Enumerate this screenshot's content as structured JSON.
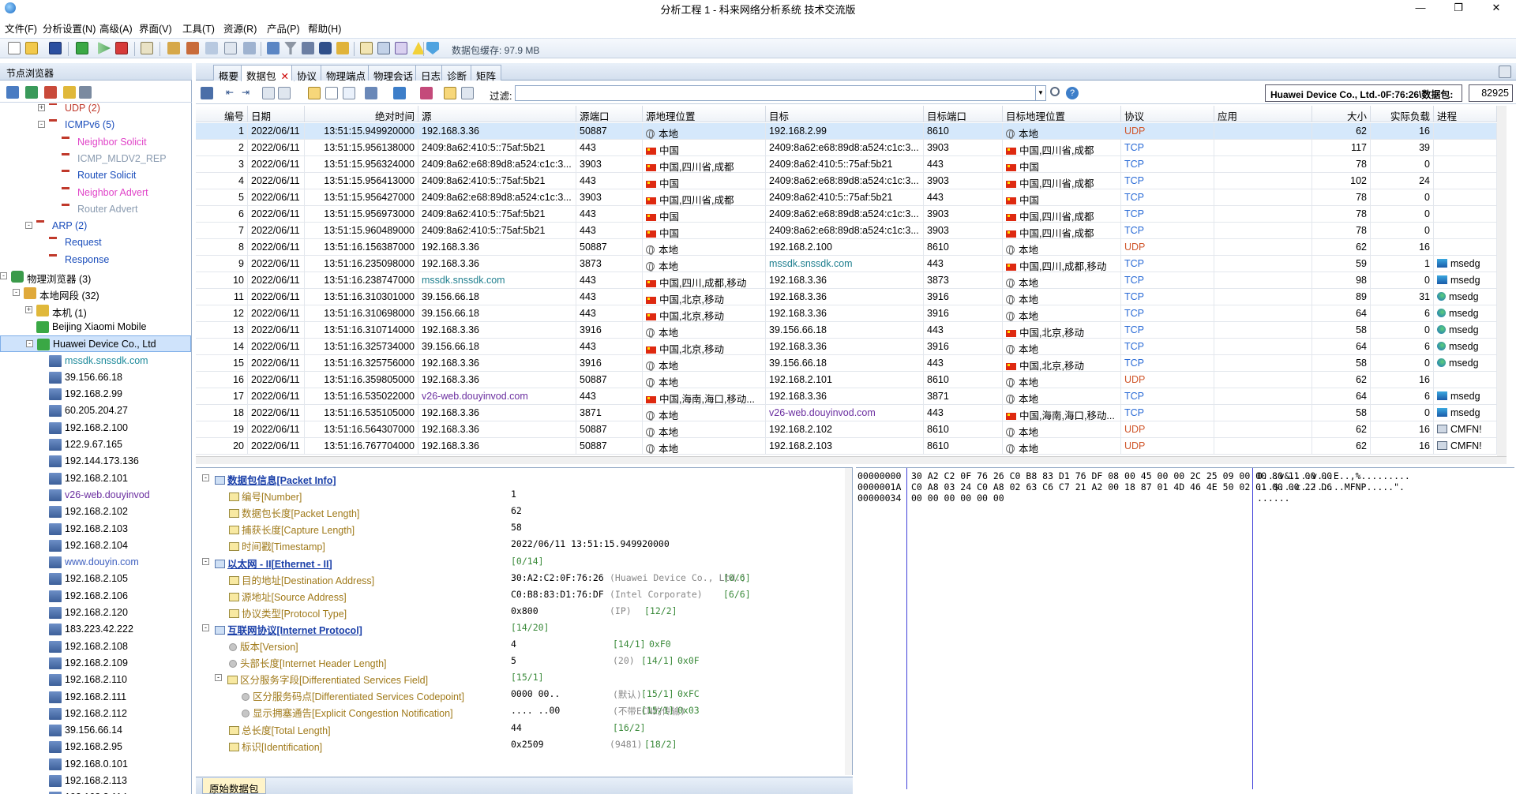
{
  "window": {
    "title": "分析工程 1 - 科来网络分析系统 技术交流版",
    "minimize": "—",
    "maximize": "❐",
    "close": "✕"
  },
  "menu": [
    "文件(F)",
    "分析设置(N)",
    "高级(A)",
    "界面(V)",
    "工具(T)",
    "资源(R)",
    "产品(P)",
    "帮助(H)"
  ],
  "toolbar": {
    "cache_label": "数据包缓存: 97.9 MB"
  },
  "left_panel": {
    "title": "节点浏览器",
    "tree": [
      {
        "label": "UDP (2)",
        "color": "red",
        "level": 4,
        "icon": "protocol-icon",
        "expander": "+"
      },
      {
        "label": "ICMPv6 (5)",
        "color": "blue",
        "level": 4,
        "icon": "protocol-icon",
        "expander": "-"
      },
      {
        "label": "Neighbor Solicit",
        "color": "pink",
        "level": 5,
        "icon": "protocol-icon"
      },
      {
        "label": "ICMP_MLDV2_REP",
        "color": "gray",
        "level": 5,
        "icon": "protocol-icon"
      },
      {
        "label": "Router Solicit",
        "color": "blue",
        "level": 5,
        "icon": "protocol-icon"
      },
      {
        "label": "Neighbor Advert",
        "color": "pink",
        "level": 5,
        "icon": "protocol-icon"
      },
      {
        "label": "Router Advert",
        "color": "gray",
        "level": 5,
        "icon": "protocol-icon"
      },
      {
        "label": "ARP (2)",
        "color": "blue",
        "level": 3,
        "icon": "protocol-icon",
        "expander": "-"
      },
      {
        "label": "Request",
        "color": "blue",
        "level": 4,
        "icon": "protocol-icon"
      },
      {
        "label": "Response",
        "color": "blue",
        "level": 4,
        "icon": "protocol-icon"
      },
      {
        "label": "物理浏览器 (3)",
        "color": "black",
        "level": 1,
        "icon": "physical-icon",
        "expander": "-"
      },
      {
        "label": "本地网段 (32)",
        "color": "black",
        "level": 2,
        "icon": "segment-icon",
        "expander": "-"
      },
      {
        "label": "本机 (1)",
        "color": "black",
        "level": 3,
        "icon": "host-icon",
        "expander": "+"
      },
      {
        "label": "Beijing Xiaomi Mobile",
        "color": "black",
        "level": 3,
        "icon": "node-icon"
      },
      {
        "label": "Huawei Device Co., Ltd",
        "color": "black",
        "level": 3,
        "icon": "node-icon",
        "expander": "-",
        "selected": true
      },
      {
        "label": "mssdk.snssdk.com",
        "color": "teal",
        "level": 4,
        "icon": "pc-icon"
      },
      {
        "label": "39.156.66.18",
        "color": "black",
        "level": 4,
        "icon": "pc-icon"
      },
      {
        "label": "192.168.2.99",
        "color": "black",
        "level": 4,
        "icon": "pc-icon"
      },
      {
        "label": "60.205.204.27",
        "color": "black",
        "level": 4,
        "icon": "pc-icon"
      },
      {
        "label": "192.168.2.100",
        "color": "black",
        "level": 4,
        "icon": "pc-icon"
      },
      {
        "label": "122.9.67.165",
        "color": "black",
        "level": 4,
        "icon": "pc-icon"
      },
      {
        "label": "192.144.173.136",
        "color": "black",
        "level": 4,
        "icon": "pc-icon"
      },
      {
        "label": "192.168.2.101",
        "color": "black",
        "level": 4,
        "icon": "pc-icon"
      },
      {
        "label": "v26-web.douyinvod",
        "color": "purple",
        "level": 4,
        "icon": "pc-icon"
      },
      {
        "label": "192.168.2.102",
        "color": "black",
        "level": 4,
        "icon": "pc-icon"
      },
      {
        "label": "192.168.2.103",
        "color": "black",
        "level": 4,
        "icon": "pc-icon"
      },
      {
        "label": "192.168.2.104",
        "color": "black",
        "level": 4,
        "icon": "pc-icon"
      },
      {
        "label": "www.douyin.com",
        "color": "link",
        "level": 4,
        "icon": "pc-icon"
      },
      {
        "label": "192.168.2.105",
        "color": "black",
        "level": 4,
        "icon": "pc-icon"
      },
      {
        "label": "192.168.2.106",
        "color": "black",
        "level": 4,
        "icon": "pc-icon"
      },
      {
        "label": "192.168.2.120",
        "color": "black",
        "level": 4,
        "icon": "pc-icon"
      },
      {
        "label": "183.223.42.222",
        "color": "black",
        "level": 4,
        "icon": "pc-icon"
      },
      {
        "label": "192.168.2.108",
        "color": "black",
        "level": 4,
        "icon": "pc-icon"
      },
      {
        "label": "192.168.2.109",
        "color": "black",
        "level": 4,
        "icon": "pc-icon"
      },
      {
        "label": "192.168.2.110",
        "color": "black",
        "level": 4,
        "icon": "pc-icon"
      },
      {
        "label": "192.168.2.111",
        "color": "black",
        "level": 4,
        "icon": "pc-icon"
      },
      {
        "label": "192.168.2.112",
        "color": "black",
        "level": 4,
        "icon": "pc-icon"
      },
      {
        "label": "39.156.66.14",
        "color": "black",
        "level": 4,
        "icon": "pc-icon"
      },
      {
        "label": "192.168.2.95",
        "color": "black",
        "level": 4,
        "icon": "pc-icon"
      },
      {
        "label": "192.168.0.101",
        "color": "black",
        "level": 4,
        "icon": "pc-icon"
      },
      {
        "label": "192.168.2.113",
        "color": "black",
        "level": 4,
        "icon": "pc-icon"
      },
      {
        "label": "192.168.2.114",
        "color": "black",
        "level": 4,
        "icon": "pc-icon"
      }
    ]
  },
  "tabs": [
    {
      "label": "概要",
      "active": false
    },
    {
      "label": "数据包",
      "active": true,
      "close": "✕"
    },
    {
      "label": "协议",
      "active": false
    },
    {
      "label": "物理端点",
      "active": false
    },
    {
      "label": "物理会话",
      "active": false
    },
    {
      "label": "日志",
      "active": false
    },
    {
      "label": "诊断",
      "active": false
    },
    {
      "label": "矩阵",
      "active": false
    }
  ],
  "filterbar": {
    "filter_label": "过滤:",
    "filter_value": "",
    "device_label": "Huawei Device Co., Ltd.-0F:76:26\\数据包:",
    "packet_count": "82925"
  },
  "packet_table": {
    "columns": [
      "编号",
      "日期",
      "绝对时间",
      "源",
      "源端口",
      "源地理位置",
      "目标",
      "目标端口",
      "目标地理位置",
      "协议",
      "应用",
      "大小",
      "实际负载",
      "进程"
    ],
    "rows": [
      {
        "no": "1",
        "date": "2022/06/11",
        "time": "13:51:15.949920000",
        "src": "192.168.3.36",
        "sport": "50887",
        "sgeo": "本地",
        "sflag": "local",
        "dst": "192.168.2.99",
        "dport": "8610",
        "dgeo": "本地",
        "dflag": "local",
        "proto": "UDP",
        "app": "",
        "size": "62",
        "payload": "16",
        "proc": "",
        "selected": true
      },
      {
        "no": "2",
        "date": "2022/06/11",
        "time": "13:51:15.956138000",
        "src": "2409:8a62:410:5::75af:5b21",
        "sport": "443",
        "sgeo": "中国",
        "sflag": "cn",
        "dst": "2409:8a62:e68:89d8:a524:c1c:3...",
        "dport": "3903",
        "dgeo": "中国,四川省,成都",
        "dflag": "cn",
        "proto": "TCP",
        "app": "",
        "size": "117",
        "payload": "39",
        "proc": ""
      },
      {
        "no": "3",
        "date": "2022/06/11",
        "time": "13:51:15.956324000",
        "src": "2409:8a62:e68:89d8:a524:c1c:3...",
        "sport": "3903",
        "sgeo": "中国,四川省,成都",
        "sflag": "cn",
        "dst": "2409:8a62:410:5::75af:5b21",
        "dport": "443",
        "dgeo": "中国",
        "dflag": "cn",
        "proto": "TCP",
        "app": "",
        "size": "78",
        "payload": "0",
        "proc": ""
      },
      {
        "no": "4",
        "date": "2022/06/11",
        "time": "13:51:15.956413000",
        "src": "2409:8a62:410:5::75af:5b21",
        "sport": "443",
        "sgeo": "中国",
        "sflag": "cn",
        "dst": "2409:8a62:e68:89d8:a524:c1c:3...",
        "dport": "3903",
        "dgeo": "中国,四川省,成都",
        "dflag": "cn",
        "proto": "TCP",
        "app": "",
        "size": "102",
        "payload": "24",
        "proc": ""
      },
      {
        "no": "5",
        "date": "2022/06/11",
        "time": "13:51:15.956427000",
        "src": "2409:8a62:e68:89d8:a524:c1c:3...",
        "sport": "3903",
        "sgeo": "中国,四川省,成都",
        "sflag": "cn",
        "dst": "2409:8a62:410:5::75af:5b21",
        "dport": "443",
        "dgeo": "中国",
        "dflag": "cn",
        "proto": "TCP",
        "app": "",
        "size": "78",
        "payload": "0",
        "proc": ""
      },
      {
        "no": "6",
        "date": "2022/06/11",
        "time": "13:51:15.956973000",
        "src": "2409:8a62:410:5::75af:5b21",
        "sport": "443",
        "sgeo": "中国",
        "sflag": "cn",
        "dst": "2409:8a62:e68:89d8:a524:c1c:3...",
        "dport": "3903",
        "dgeo": "中国,四川省,成都",
        "dflag": "cn",
        "proto": "TCP",
        "app": "",
        "size": "78",
        "payload": "0",
        "proc": ""
      },
      {
        "no": "7",
        "date": "2022/06/11",
        "time": "13:51:15.960489000",
        "src": "2409:8a62:410:5::75af:5b21",
        "sport": "443",
        "sgeo": "中国",
        "sflag": "cn",
        "dst": "2409:8a62:e68:89d8:a524:c1c:3...",
        "dport": "3903",
        "dgeo": "中国,四川省,成都",
        "dflag": "cn",
        "proto": "TCP",
        "app": "",
        "size": "78",
        "payload": "0",
        "proc": ""
      },
      {
        "no": "8",
        "date": "2022/06/11",
        "time": "13:51:16.156387000",
        "src": "192.168.3.36",
        "sport": "50887",
        "sgeo": "本地",
        "sflag": "local",
        "dst": "192.168.2.100",
        "dport": "8610",
        "dgeo": "本地",
        "dflag": "local",
        "proto": "UDP",
        "app": "",
        "size": "62",
        "payload": "16",
        "proc": ""
      },
      {
        "no": "9",
        "date": "2022/06/11",
        "time": "13:51:16.235098000",
        "src": "192.168.3.36",
        "sport": "3873",
        "sgeo": "本地",
        "sflag": "local",
        "dst": "mssdk.snssdk.com",
        "dstcls": "domain",
        "dport": "443",
        "dgeo": "中国,四川,成都,移动",
        "dflag": "cn",
        "proto": "TCP",
        "app": "",
        "size": "59",
        "payload": "1",
        "proc": "msedg",
        "pico": "monitor"
      },
      {
        "no": "10",
        "date": "2022/06/11",
        "time": "13:51:16.238747000",
        "src": "mssdk.snssdk.com",
        "srccls": "domain",
        "sport": "443",
        "sgeo": "中国,四川,成都,移动",
        "sflag": "cn",
        "dst": "192.168.3.36",
        "dport": "3873",
        "dgeo": "本地",
        "dflag": "local",
        "proto": "TCP",
        "app": "",
        "size": "98",
        "payload": "0",
        "proc": "msedg",
        "pico": "monitor"
      },
      {
        "no": "11",
        "date": "2022/06/11",
        "time": "13:51:16.310301000",
        "src": "39.156.66.18",
        "sport": "443",
        "sgeo": "中国,北京,移动",
        "sflag": "cn",
        "dst": "192.168.3.36",
        "dport": "3916",
        "dgeo": "本地",
        "dflag": "local",
        "proto": "TCP",
        "app": "",
        "size": "89",
        "payload": "31",
        "proc": "msedg",
        "pico": "edge"
      },
      {
        "no": "12",
        "date": "2022/06/11",
        "time": "13:51:16.310698000",
        "src": "39.156.66.18",
        "sport": "443",
        "sgeo": "中国,北京,移动",
        "sflag": "cn",
        "dst": "192.168.3.36",
        "dport": "3916",
        "dgeo": "本地",
        "dflag": "local",
        "proto": "TCP",
        "app": "",
        "size": "64",
        "payload": "6",
        "proc": "msedg",
        "pico": "edge"
      },
      {
        "no": "13",
        "date": "2022/06/11",
        "time": "13:51:16.310714000",
        "src": "192.168.3.36",
        "sport": "3916",
        "sgeo": "本地",
        "sflag": "local",
        "dst": "39.156.66.18",
        "dport": "443",
        "dgeo": "中国,北京,移动",
        "dflag": "cn",
        "proto": "TCP",
        "app": "",
        "size": "58",
        "payload": "0",
        "proc": "msedg",
        "pico": "edge"
      },
      {
        "no": "14",
        "date": "2022/06/11",
        "time": "13:51:16.325734000",
        "src": "39.156.66.18",
        "sport": "443",
        "sgeo": "中国,北京,移动",
        "sflag": "cn",
        "dst": "192.168.3.36",
        "dport": "3916",
        "dgeo": "本地",
        "dflag": "local",
        "proto": "TCP",
        "app": "",
        "size": "64",
        "payload": "6",
        "proc": "msedg",
        "pico": "edge"
      },
      {
        "no": "15",
        "date": "2022/06/11",
        "time": "13:51:16.325756000",
        "src": "192.168.3.36",
        "sport": "3916",
        "sgeo": "本地",
        "sflag": "local",
        "dst": "39.156.66.18",
        "dport": "443",
        "dgeo": "中国,北京,移动",
        "dflag": "cn",
        "proto": "TCP",
        "app": "",
        "size": "58",
        "payload": "0",
        "proc": "msedg",
        "pico": "edge"
      },
      {
        "no": "16",
        "date": "2022/06/11",
        "time": "13:51:16.359805000",
        "src": "192.168.3.36",
        "sport": "50887",
        "sgeo": "本地",
        "sflag": "local",
        "dst": "192.168.2.101",
        "dport": "8610",
        "dgeo": "本地",
        "dflag": "local",
        "proto": "UDP",
        "app": "",
        "size": "62",
        "payload": "16",
        "proc": ""
      },
      {
        "no": "17",
        "date": "2022/06/11",
        "time": "13:51:16.535022000",
        "src": "v26-web.douyinvod.com",
        "srccls": "domain2",
        "sport": "443",
        "sgeo": "中国,海南,海口,移动...",
        "sflag": "cn",
        "dst": "192.168.3.36",
        "dport": "3871",
        "dgeo": "本地",
        "dflag": "local",
        "proto": "TCP",
        "app": "",
        "size": "64",
        "payload": "6",
        "proc": "msedg",
        "pico": "monitor"
      },
      {
        "no": "18",
        "date": "2022/06/11",
        "time": "13:51:16.535105000",
        "src": "192.168.3.36",
        "sport": "3871",
        "sgeo": "本地",
        "sflag": "local",
        "dst": "v26-web.douyinvod.com",
        "dstcls": "domain2",
        "dport": "443",
        "dgeo": "中国,海南,海口,移动...",
        "dflag": "cn",
        "proto": "TCP",
        "app": "",
        "size": "58",
        "payload": "0",
        "proc": "msedg",
        "pico": "monitor"
      },
      {
        "no": "19",
        "date": "2022/06/11",
        "time": "13:51:16.564307000",
        "src": "192.168.3.36",
        "sport": "50887",
        "sgeo": "本地",
        "sflag": "local",
        "dst": "192.168.2.102",
        "dport": "8610",
        "dgeo": "本地",
        "dflag": "local",
        "proto": "UDP",
        "app": "",
        "size": "62",
        "payload": "16",
        "proc": "CMFN!",
        "pico": "cmfn"
      },
      {
        "no": "20",
        "date": "2022/06/11",
        "time": "13:51:16.767704000",
        "src": "192.168.3.36",
        "sport": "50887",
        "sgeo": "本地",
        "sflag": "local",
        "dst": "192.168.2.103",
        "dport": "8610",
        "dgeo": "本地",
        "dflag": "local",
        "proto": "UDP",
        "app": "",
        "size": "62",
        "payload": "16",
        "proc": "CMFN!",
        "pico": "cmfn"
      }
    ]
  },
  "decode": {
    "rows": [
      {
        "kind": "section",
        "label": "数据包信息[Packet Info]",
        "level": 0,
        "expander": "-"
      },
      {
        "kind": "field",
        "label": "编号[Number]",
        "value": "1",
        "level": 1,
        "icon": "bookmark"
      },
      {
        "kind": "field",
        "label": "数据包长度[Packet Length]",
        "value": "62",
        "level": 1,
        "icon": "bookmark"
      },
      {
        "kind": "field",
        "label": "捕获长度[Capture Length]",
        "value": "58",
        "level": 1,
        "icon": "bookmark"
      },
      {
        "kind": "field",
        "label": "时间戳[Timestamp]",
        "value": "2022/06/11 13:51:15.949920000",
        "level": 1,
        "icon": "bookmark"
      },
      {
        "kind": "section",
        "label": "以太网 - II[Ethernet - II]",
        "value": "[0/14]",
        "level": 0,
        "expander": "-"
      },
      {
        "kind": "field",
        "label": "目的地址[Destination Address]",
        "value": "30:A2:C2:0F:76:26",
        "extra": "(Huawei Device Co., Ltd.)",
        "off": "[0/6]",
        "level": 1,
        "icon": "bookmark"
      },
      {
        "kind": "field",
        "label": "源地址[Source Address]",
        "value": "C0:B8:83:D1:76:DF",
        "extra": "(Intel Corporate)",
        "off": "[6/6]",
        "level": 1,
        "icon": "bookmark"
      },
      {
        "kind": "field",
        "label": "协议类型[Protocol Type]",
        "value": "0x800",
        "extra": "(IP)",
        "off": "[12/2]",
        "level": 1,
        "icon": "bookmark"
      },
      {
        "kind": "section",
        "label": "互联网协议[Internet Protocol]",
        "value": "[14/20]",
        "level": 0,
        "expander": "-"
      },
      {
        "kind": "field",
        "label": "版本[Version]",
        "value": "4",
        "off": "[14/1]",
        "hex": "0xF0",
        "level": 1,
        "icon": "dot"
      },
      {
        "kind": "field",
        "label": "头部长度[Internet Header Length]",
        "value": "5",
        "extra": "(20)",
        "off": "[14/1]",
        "hex": "0x0F",
        "level": 1,
        "icon": "dot"
      },
      {
        "kind": "field",
        "label": "区分服务字段[Differentiated Services Field]",
        "value": "[15/1]",
        "level": 1,
        "icon": "bookmark",
        "expander": "-"
      },
      {
        "kind": "field",
        "label": "区分服务码点[Differentiated Services Codepoint]",
        "value": "0000 00..",
        "extra": "(默认)",
        "off": "[15/1]",
        "hex": "0xFC",
        "level": 2,
        "icon": "dot"
      },
      {
        "kind": "field",
        "label": "显示拥塞通告[Explicit Congestion Notification]",
        "value": ".... ..00",
        "extra": "(不带ECN的传输)",
        "off": "[15/1]",
        "hex": "0x03",
        "level": 2,
        "icon": "dot"
      },
      {
        "kind": "field",
        "label": "总长度[Total Length]",
        "value": "44",
        "off": "[16/2]",
        "level": 1,
        "icon": "bookmark"
      },
      {
        "kind": "field",
        "label": "标识[Identification]",
        "value": "0x2509",
        "extra": "(9481)",
        "off": "[18/2]",
        "level": 1,
        "icon": "bookmark"
      }
    ]
  },
  "hex": {
    "offsets": [
      "00000000",
      "0000001A",
      "00000034"
    ],
    "bytes": [
      "30 A2 C2 0F 76 26 C0 B8 83 D1 76 DF 08 00 45 00 00 2C 25 09 00 00 80 11 00 00",
      "C0 A8 03 24 C0 A8 02 63 C6 C7 21 A2 00 18 87 01 4D 46 4E 50 02 01 00 00 22 D6",
      "00 00 00 00 00 00"
    ],
    "ascii": [
      "0...v&....v...E..,%.........",
      "...$...c..!.....MFNP.....\".",
      "......"
    ]
  },
  "bottom_tab": "原始数据包"
}
